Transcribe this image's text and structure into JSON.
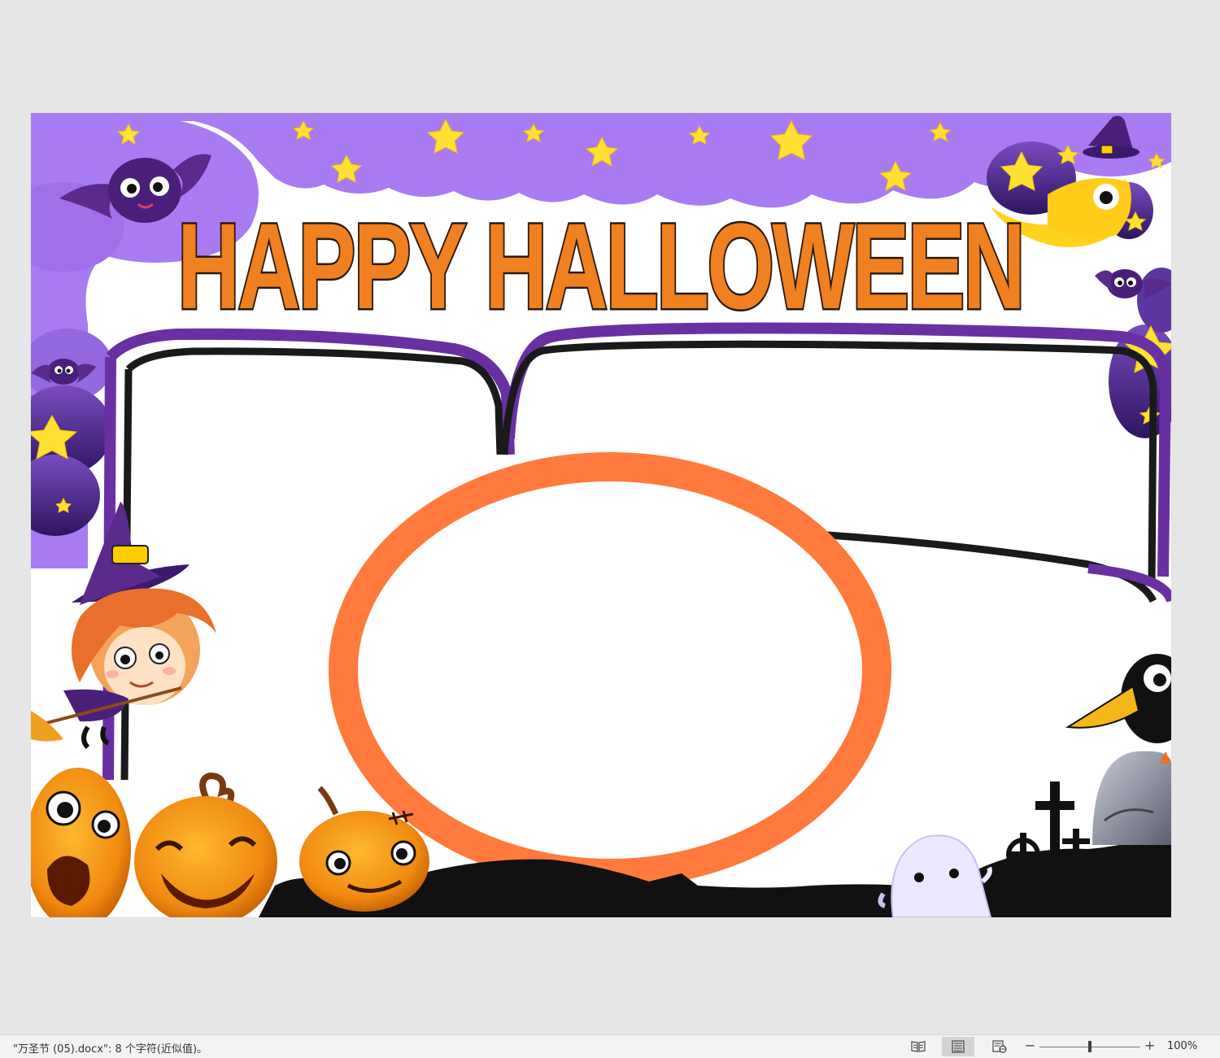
{
  "document": {
    "title_line": "HAPPY   HALLOWEEN",
    "colors": {
      "purple_light": "#a97bf2",
      "purple_dark": "#3b1a6e",
      "frame_purple": "#6a2fa3",
      "orange_title": "#f08020",
      "orange_ring": "#ff7a3c",
      "star_yellow": "#ffe033",
      "outline_black": "#1a1a1a"
    }
  },
  "statusbar": {
    "doc_info": "\"万圣节 (05).docx\": 8 个字符(近似值)。",
    "views": [
      {
        "name": "read-mode",
        "icon": "book-icon"
      },
      {
        "name": "print-layout",
        "icon": "page-lines-icon",
        "active": true
      },
      {
        "name": "web-layout",
        "icon": "web-layout-icon"
      }
    ],
    "zoom_minus": "−",
    "zoom_plus": "+",
    "zoom_level": "100%"
  }
}
